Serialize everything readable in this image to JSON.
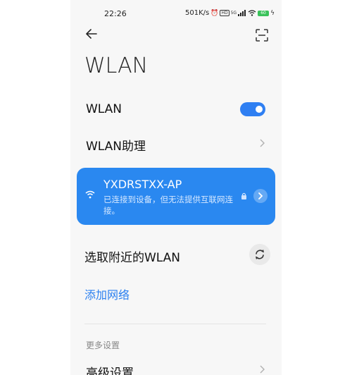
{
  "status_bar": {
    "time": "22:26",
    "net_speed": "501K/s",
    "icons": [
      "alarm-icon",
      "hd-icon",
      "5g-icon",
      "signal-icon",
      "wifi-icon",
      "battery-icon",
      "charging-icon"
    ],
    "hd_label": "HD",
    "five_g_label": "5G",
    "battery_label": "60"
  },
  "header": {
    "back_icon": "arrow-left-icon",
    "scan_icon": "scan-icon",
    "title": "WLAN"
  },
  "settings": {
    "wlan_toggle_label": "WLAN",
    "wlan_toggle_on": true,
    "wlan_assistant_label": "WLAN助理"
  },
  "connected_network": {
    "ssid": "YXDRSTXX-AP",
    "status": "已连接到设备，但无法提供互联网连接。"
  },
  "nearby": {
    "label": "选取附近的WLAN"
  },
  "add_network": {
    "label": "添加网络"
  },
  "more_settings": {
    "section_title": "更多设置",
    "advanced_label": "高级设置"
  },
  "colors": {
    "accent": "#2a88f0",
    "toggle_on": "#2f7ff2",
    "link": "#2a7ff0",
    "background": "#f7f7f7"
  }
}
